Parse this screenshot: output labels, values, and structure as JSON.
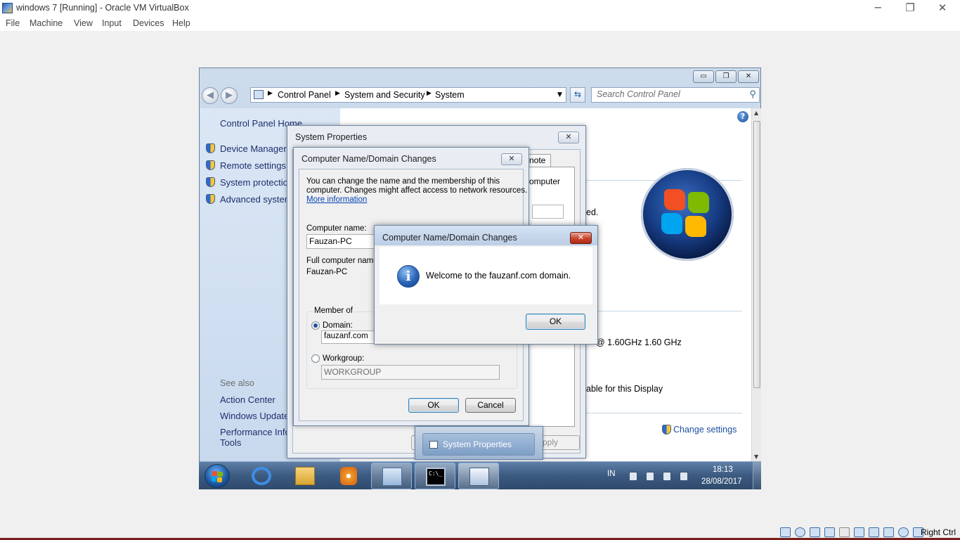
{
  "host": {
    "title": "windows 7 [Running] - Oracle VM VirtualBox",
    "controls": {
      "minimize": "─",
      "restore": "❐",
      "close": "✕"
    },
    "menu": [
      "File",
      "Machine",
      "View",
      "Input",
      "Devices",
      "Help"
    ],
    "status": {
      "icons": [
        "hard-disk-icon",
        "optical-drive-icon",
        "network-icon",
        "usb-icon",
        "shared-folders-icon",
        "display-icon",
        "video-capture-icon",
        "cpu-icon",
        "mouse-integration-icon",
        "keyboard-icon"
      ],
      "host_key": "Right Ctrl"
    }
  },
  "control_panel": {
    "nav": {
      "back": "◀",
      "forward": "▶"
    },
    "breadcrumbs": [
      "Control Panel",
      "System and Security",
      "System"
    ],
    "search_placeholder": "Search Control Panel",
    "left_links": [
      "Control Panel Home",
      "Device Manager",
      "Remote settings",
      "System protection",
      "Advanced system"
    ],
    "see_also_heading": "See also",
    "see_also_links": [
      "Action Center",
      "Windows Update",
      "Performance Infor",
      "Tools"
    ],
    "main_fragments": {
      "protected": "ed.",
      "processor": "@ 1.60GHz   1.60 GHz",
      "pen_touch": "able for this Display",
      "change_settings": "Change settings"
    }
  },
  "system_properties": {
    "title": "System Properties",
    "close": "✕",
    "tab_remote": "note",
    "fragment_computer": "omputer",
    "apply_label": "pply"
  },
  "name_dialog": {
    "title": "Computer Name/Domain Changes",
    "close": "✕",
    "intro_line1": "You can change the name and the membership of this",
    "intro_line2": "computer. Changes might affect access to network resources.",
    "more_info": "More information",
    "computer_name_label": "Computer name:",
    "computer_name_value": "Fauzan-PC",
    "full_name_label": "Full computer name:",
    "full_name_value": "Fauzan-PC",
    "member_of": "Member of",
    "domain_label": "Domain:",
    "domain_value": "fauzanf.com",
    "workgroup_label": "Workgroup:",
    "workgroup_value": "WORKGROUP",
    "ok": "OK",
    "cancel": "Cancel"
  },
  "message_box": {
    "title": "Computer Name/Domain Changes",
    "close": "✕",
    "message": "Welcome to the fauzanf.com domain.",
    "ok": "OK",
    "icon": "information-icon"
  },
  "taskbar_preview": {
    "label": "System Properties"
  },
  "taskbar": {
    "pinned": [
      "internet-explorer-icon",
      "windows-explorer-icon",
      "media-player-icon",
      "control-panel-icon",
      "command-prompt-icon",
      "system-properties-icon"
    ],
    "cmd_label": "C:\\_",
    "language": "IN",
    "time": "18:13",
    "date": "28/08/2017"
  }
}
